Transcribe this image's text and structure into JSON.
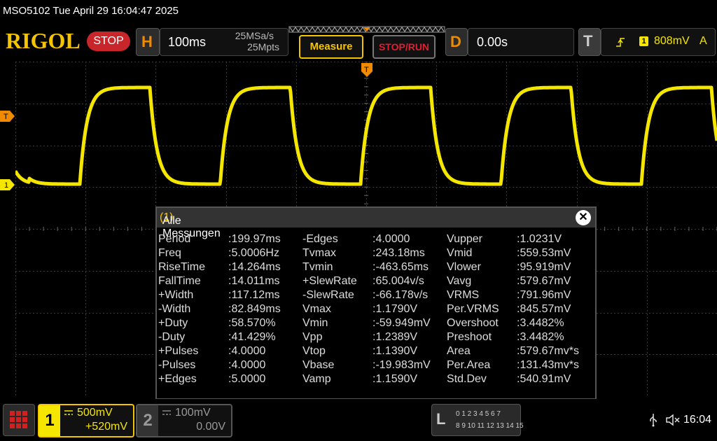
{
  "titlebar": {
    "text": "MSO5102  Tue April 29 16:04:47 2025"
  },
  "header": {
    "logo": "RIGOL",
    "status": "STOP",
    "horizontal": {
      "letter": "H",
      "timebase": "100ms",
      "sample_rate": "25MSa/s",
      "memory_depth": "25Mpts"
    },
    "measure_button": "Measure",
    "stoprun_button": "STOP/RUN",
    "delay": {
      "letter": "D",
      "value": "0.00s"
    },
    "trigger": {
      "letter": "T",
      "source": "1",
      "level": "808mV",
      "mode": "A"
    }
  },
  "markers": {
    "trigger_pos": "T",
    "trigger_level": "T",
    "ch1_ground": "1"
  },
  "measurements": {
    "title": "Alle Messungen",
    "count": "(1)",
    "rows": [
      [
        [
          "Period",
          ":199.97ms"
        ],
        [
          "-Edges",
          ":4.0000"
        ],
        [
          "Vupper",
          ":1.0231V"
        ]
      ],
      [
        [
          "Freq",
          ":5.0006Hz"
        ],
        [
          "Tvmax",
          ":243.18ms"
        ],
        [
          "Vmid",
          ":559.53mV"
        ]
      ],
      [
        [
          "RiseTime",
          ":14.264ms"
        ],
        [
          "Tvmin",
          ":-463.65ms"
        ],
        [
          "Vlower",
          ":95.919mV"
        ]
      ],
      [
        [
          "FallTime",
          ":14.011ms"
        ],
        [
          "+SlewRate",
          ":65.004v/s"
        ],
        [
          "Vavg",
          ":579.67mV"
        ]
      ],
      [
        [
          "+Width",
          ":117.12ms"
        ],
        [
          "-SlewRate",
          ":-66.178v/s"
        ],
        [
          "VRMS",
          ":791.96mV"
        ]
      ],
      [
        [
          "-Width",
          ":82.849ms"
        ],
        [
          "Vmax",
          ":1.1790V"
        ],
        [
          "Per.VRMS",
          ":845.57mV"
        ]
      ],
      [
        [
          "+Duty",
          ":58.570%"
        ],
        [
          "Vmin",
          ":-59.949mV"
        ],
        [
          "Overshoot",
          ":3.4482%"
        ]
      ],
      [
        [
          "-Duty",
          ":41.429%"
        ],
        [
          "Vpp",
          ":1.2389V"
        ],
        [
          "Preshoot",
          ":3.4482%"
        ]
      ],
      [
        [
          "+Pulses",
          ":4.0000"
        ],
        [
          "Vtop",
          ":1.1390V"
        ],
        [
          "Area",
          ":579.67mv*s"
        ]
      ],
      [
        [
          "-Pulses",
          ":4.0000"
        ],
        [
          "Vbase",
          ":-19.983mV"
        ],
        [
          "Per.Area",
          ":131.43mv*s"
        ]
      ],
      [
        [
          "+Edges",
          ":5.0000"
        ],
        [
          "Vamp",
          ":1.1590V"
        ],
        [
          "Std.Dev",
          ":540.91mV"
        ]
      ]
    ]
  },
  "channels": {
    "ch1": {
      "number": "1",
      "scale": "500mV",
      "offset": "+520mV"
    },
    "ch2": {
      "number": "2",
      "scale": "100mV",
      "offset": "0.00V"
    }
  },
  "logic": {
    "letter": "L",
    "row1": "0 1 2 3  4 5 6 7",
    "row2": "8 9 10 11 12 13 14 15"
  },
  "statusbar": {
    "time": "16:04"
  },
  "colors": {
    "ch1": "#f5e600",
    "accent": "#f08a00",
    "grid": "#3a3a3a"
  }
}
